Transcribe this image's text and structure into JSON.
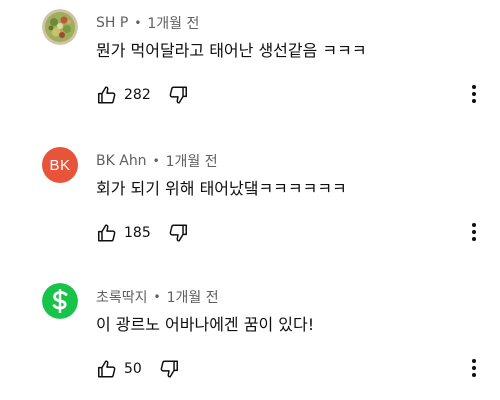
{
  "colors": {
    "text_primary": "#0f0f0f",
    "text_secondary": "#606060",
    "avatar_bk": "#e8543a",
    "avatar_cash": "#19c34a"
  },
  "comments": [
    {
      "author": "SH P",
      "separator": "•",
      "time": "1개월 전",
      "text": "뭔가 먹어달라고 태어난 생선같음 ㅋㅋㅋ",
      "likes": "282",
      "avatar_icon": "salad-photo-avatar"
    },
    {
      "author": "BK Ahn",
      "separator": "•",
      "time": "1개월 전",
      "text": "회가 되기 위해 태어났댘ㅋㅋㅋㅋㅋㅋ",
      "likes": "185",
      "avatar_letters": "BK",
      "avatar_icon": "initials-avatar"
    },
    {
      "author": "초록딱지",
      "separator": "•",
      "time": "1개월 전",
      "text": "이 광르노 어바나에겐 꿈이 있다!",
      "likes": "50",
      "avatar_icon": "dollar-sign-avatar"
    }
  ]
}
